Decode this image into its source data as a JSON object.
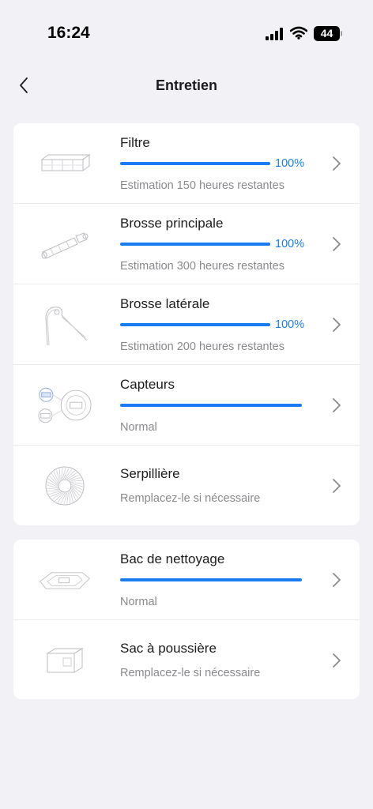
{
  "status": {
    "time": "16:24",
    "battery": "44"
  },
  "header": {
    "title": "Entretien"
  },
  "maintenance": [
    {
      "title": "Filtre",
      "progress": 1.0,
      "percent": "100%",
      "subtitle": "Estimation 150 heures restantes",
      "icon": "filter-icon"
    },
    {
      "title": "Brosse principale",
      "progress": 1.0,
      "percent": "100%",
      "subtitle": "Estimation 300 heures restantes",
      "icon": "main-brush-icon"
    },
    {
      "title": "Brosse latérale",
      "progress": 1.0,
      "percent": "100%",
      "subtitle": "Estimation 200 heures restantes",
      "icon": "side-brush-icon"
    },
    {
      "title": "Capteurs",
      "progress": 1.0,
      "subtitle": "Normal",
      "icon": "sensors-icon"
    },
    {
      "title": "Serpillière",
      "subtitle": "Remplacez-le si nécessaire",
      "icon": "mop-icon"
    }
  ],
  "accessories": [
    {
      "title": "Bac de nettoyage",
      "progress": 1.0,
      "subtitle": "Normal",
      "icon": "cleaning-tray-icon"
    },
    {
      "title": "Sac à poussière",
      "subtitle": "Remplacez-le si nécessaire",
      "icon": "dust-bag-icon"
    }
  ],
  "colors": {
    "accent": "#1a7cf2",
    "background": "#f2f2f6",
    "card": "#ffffff",
    "secondary_text": "#8a8a8e"
  }
}
